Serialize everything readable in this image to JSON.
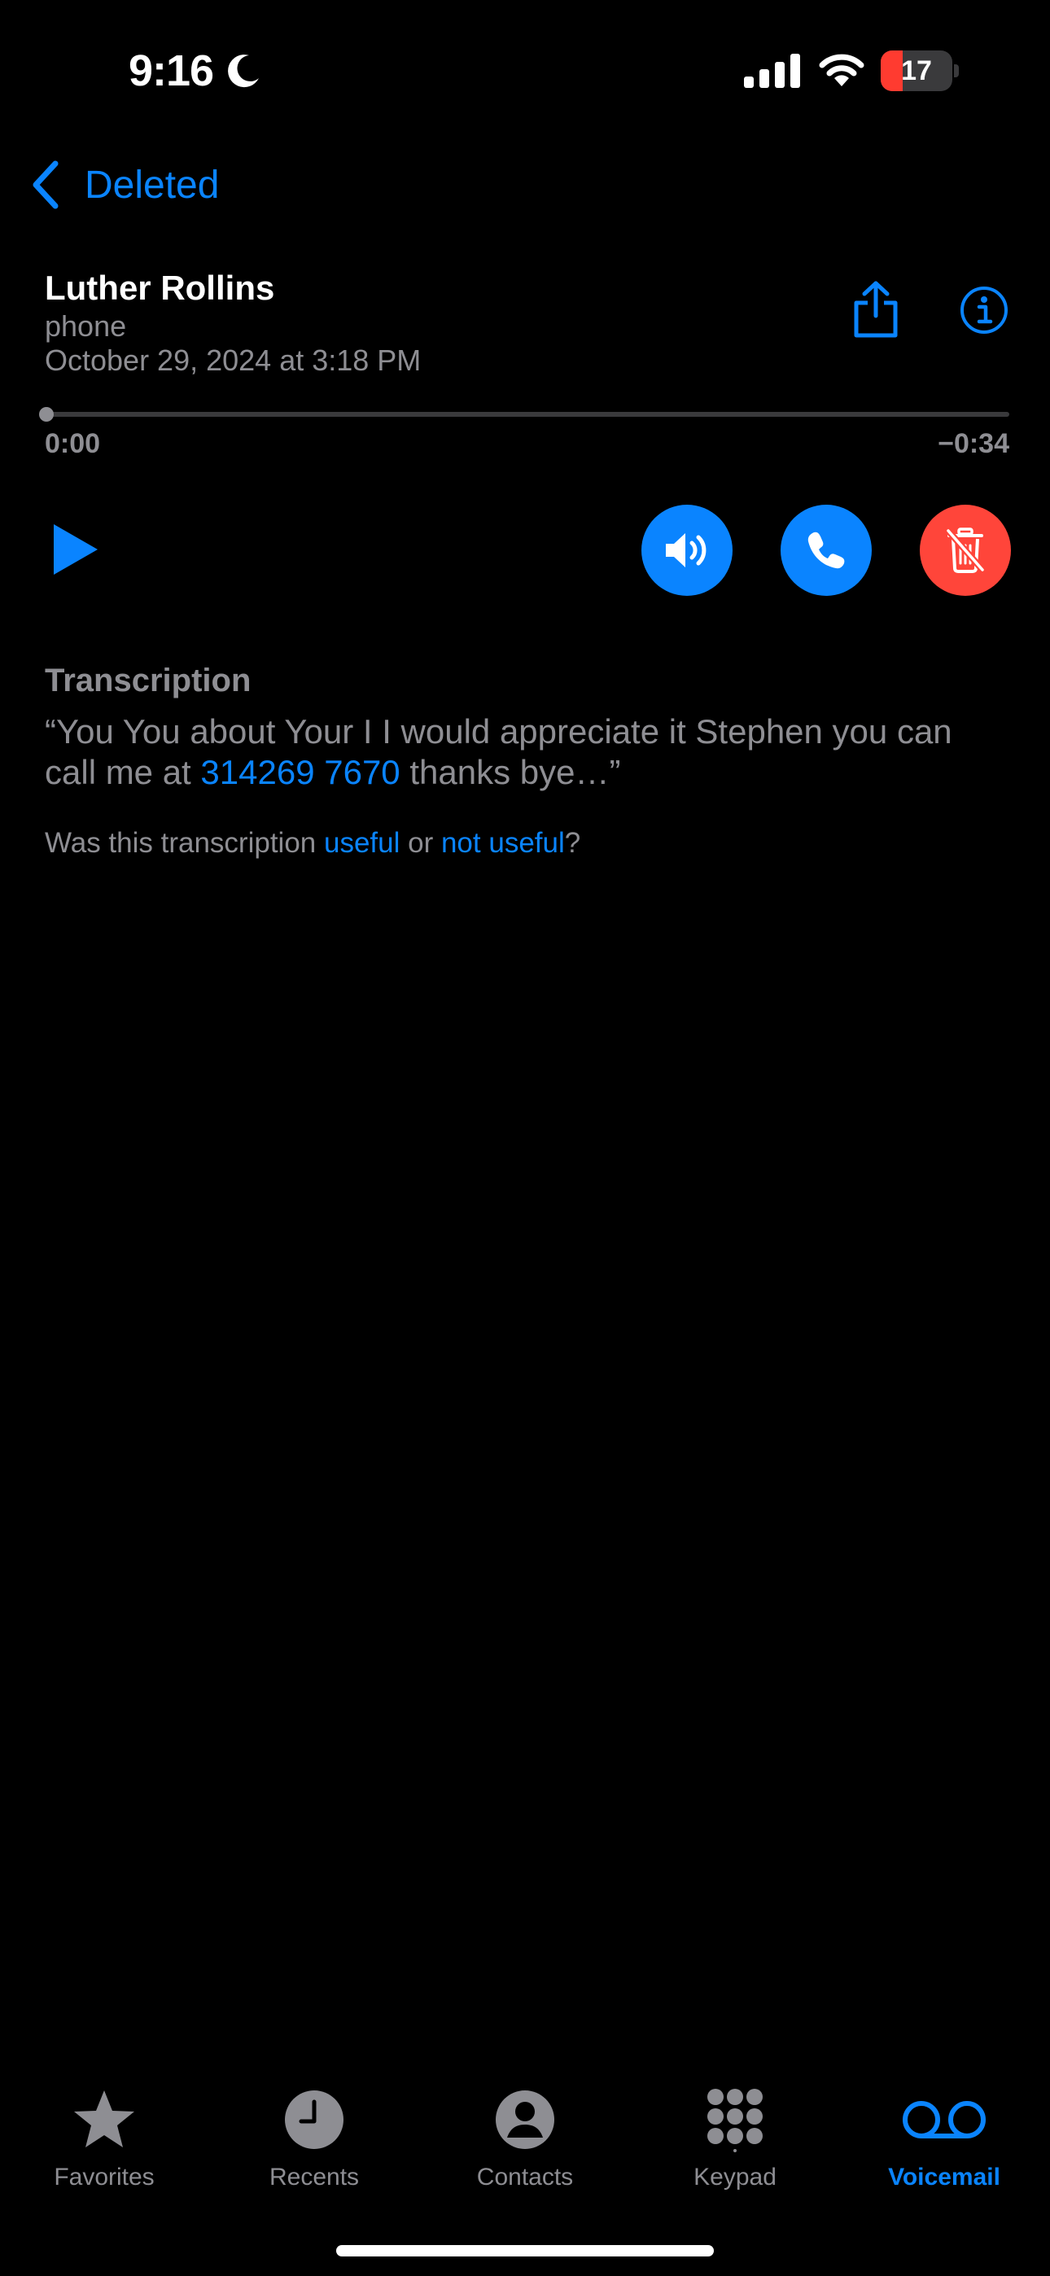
{
  "status_bar": {
    "time": "9:16",
    "battery_level": "17",
    "battery_fraction": 0.17,
    "focus_icon": "moon-icon",
    "signal_icon": "cellular-signal-icon",
    "wifi_icon": "wifi-icon"
  },
  "nav": {
    "back_label": "Deleted",
    "back_icon": "chevron-left-icon"
  },
  "voicemail": {
    "name": "Luther Rollins",
    "type": "phone",
    "date": "October 29, 2024 at 3:18 PM",
    "share_icon": "share-icon",
    "info_icon": "info-icon"
  },
  "player": {
    "elapsed": "0:00",
    "remaining": "−0:34",
    "progress": 0,
    "play_icon": "play-icon",
    "speaker_icon": "speaker-icon",
    "call_icon": "phone-icon",
    "delete_icon": "trash-slash-icon"
  },
  "transcription": {
    "title": "Transcription",
    "text_before": "“You You about Your I I would appreciate it Stephen you can  call me at ",
    "phone_link": "314269 7670",
    "text_after": " thanks bye…”",
    "feedback_prefix": "Was this transcription ",
    "useful_label": "useful",
    "feedback_or": " or ",
    "not_useful_label": "not useful",
    "feedback_suffix": "?"
  },
  "tabs": [
    {
      "label": "Favorites",
      "icon": "star-icon",
      "active": false
    },
    {
      "label": "Recents",
      "icon": "clock-icon",
      "active": false
    },
    {
      "label": "Contacts",
      "icon": "person-circle-icon",
      "active": false
    },
    {
      "label": "Keypad",
      "icon": "keypad-icon",
      "active": false
    },
    {
      "label": "Voicemail",
      "icon": "voicemail-icon",
      "active": true
    }
  ],
  "colors": {
    "accent": "#0a84ff",
    "destructive": "#ff453a",
    "secondary_text": "#8e8e93",
    "background": "#000000"
  }
}
